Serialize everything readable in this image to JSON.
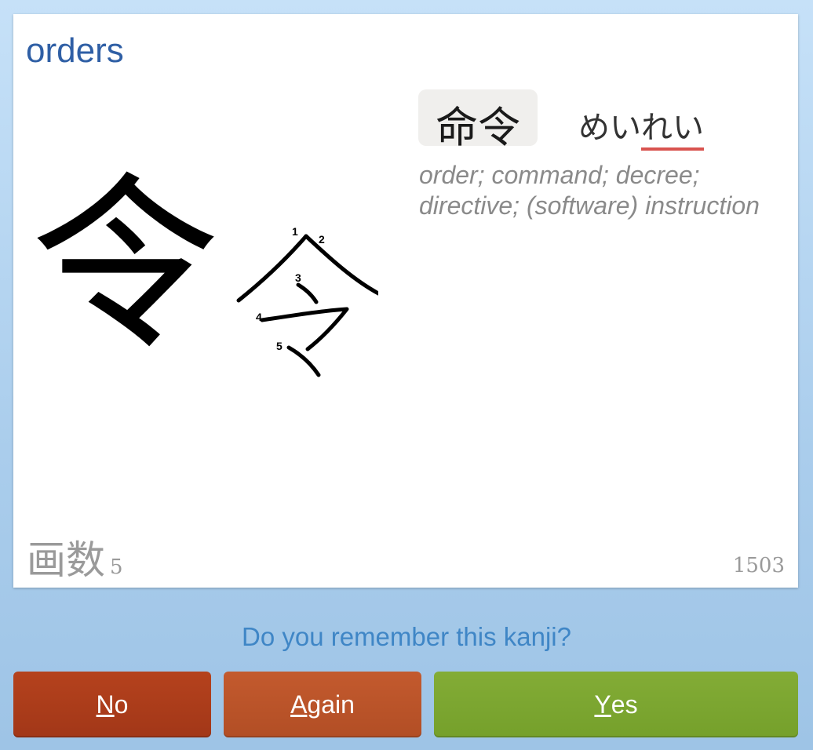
{
  "card": {
    "keyword": "orders",
    "kanji": "令",
    "vocab": {
      "word": "命令",
      "reading_prefix": "めい",
      "reading_highlight": "れい",
      "meaning": "order; command; decree; directive; (software) instruction"
    },
    "stroke_label": "画数",
    "stroke_count": "5",
    "frame_number": "1503",
    "stroke_numbers": [
      "1",
      "2",
      "3",
      "4",
      "5"
    ]
  },
  "prompt": "Do you remember this kanji?",
  "buttons": {
    "no": {
      "key": "N",
      "rest": "o"
    },
    "again": {
      "key": "A",
      "rest": "gain"
    },
    "yes": {
      "key": "Y",
      "rest": "es"
    }
  },
  "colors": {
    "keyword": "#2f5fa5",
    "prompt": "#3f86c6",
    "no": "#a93c1a",
    "again": "#bb542a",
    "yes": "#7ca631",
    "reading_underline": "#d9534f"
  }
}
